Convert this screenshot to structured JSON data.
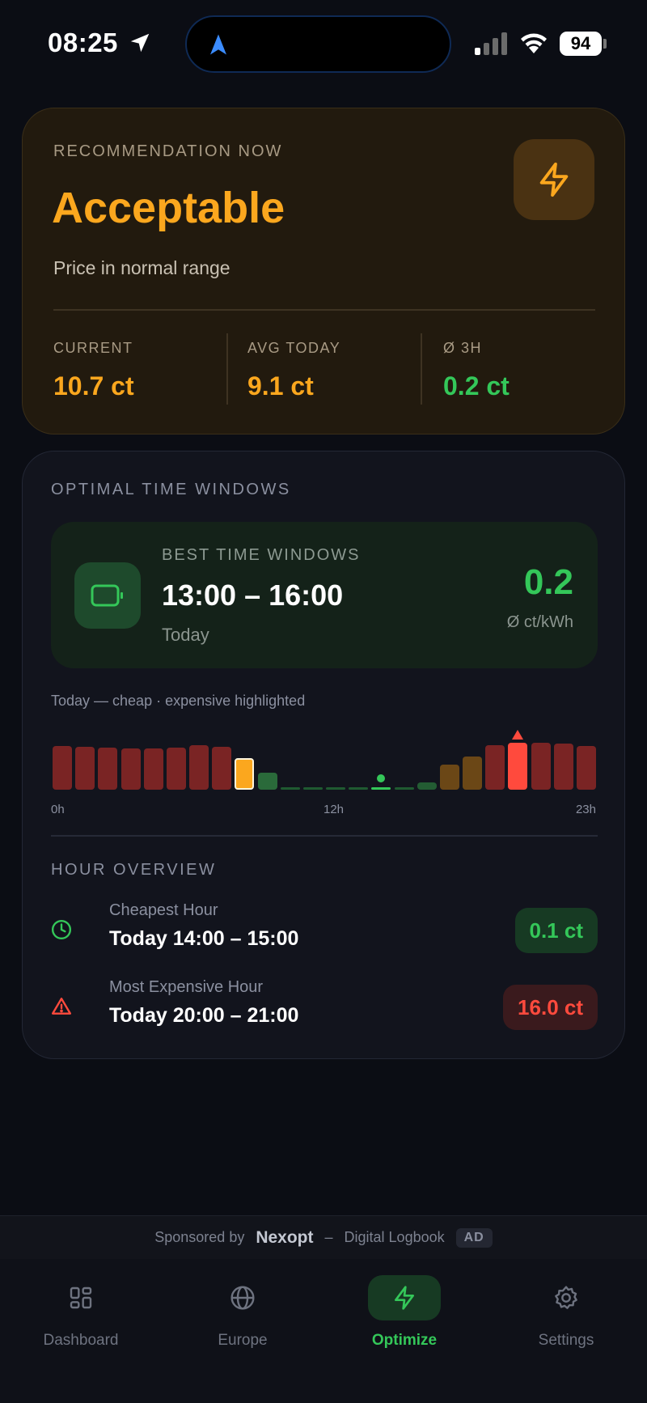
{
  "status_bar": {
    "time": "08:25",
    "battery": "94"
  },
  "colors": {
    "accent_orange": "#fba71e",
    "accent_green": "#34c759",
    "accent_red": "#ff4a3d"
  },
  "recommendation": {
    "label": "RECOMMENDATION NOW",
    "title": "Acceptable",
    "subtitle": "Price in normal range",
    "icon": "lightning-icon",
    "stats": [
      {
        "label": "CURRENT",
        "value": "10.7 ct",
        "color": "#fba71e"
      },
      {
        "label": "AVG TODAY",
        "value": "9.1 ct",
        "color": "#fba71e"
      },
      {
        "label": "Ø 3H",
        "value": "0.2 ct",
        "color": "#34c759"
      }
    ]
  },
  "optimal": {
    "label": "OPTIMAL TIME WINDOWS",
    "best": {
      "label": "BEST TIME WINDOWS",
      "time": "13:00 – 16:00",
      "day": "Today",
      "value": "0.2",
      "unit": "Ø ct/kWh",
      "icon": "battery-icon"
    },
    "chart_caption": "Today — cheap · expensive highlighted",
    "axis": {
      "start": "0h",
      "mid": "12h",
      "end": "23h"
    }
  },
  "chart_data": {
    "type": "bar",
    "categories": [
      "0",
      "1",
      "2",
      "3",
      "4",
      "5",
      "6",
      "7",
      "8",
      "9",
      "10",
      "11",
      "12",
      "13",
      "14",
      "15",
      "16",
      "17",
      "18",
      "19",
      "20",
      "21",
      "22",
      "23"
    ],
    "values": [
      14.8,
      14.6,
      14.2,
      14.0,
      14.0,
      14.3,
      15.1,
      14.6,
      10.7,
      5.8,
      0.6,
      0.4,
      0.4,
      0.5,
      0.1,
      0.7,
      2.4,
      8.4,
      11.2,
      15.1,
      16.0,
      16.0,
      15.6,
      14.8
    ],
    "categories_label_shown": [
      "0h",
      "12h",
      "23h"
    ],
    "highlight": {
      "current_hour": 8,
      "cheapest_hour": 14,
      "most_expensive_hour": 20
    },
    "ylim": [
      0,
      16.5
    ]
  },
  "hour_overview": {
    "label": "HOUR OVERVIEW",
    "cheapest": {
      "title": "Cheapest Hour",
      "time": "Today 14:00 – 15:00",
      "value": "0.1 ct",
      "icon": "clock-icon"
    },
    "expensive": {
      "title": "Most Expensive Hour",
      "time": "Today 20:00 – 21:00",
      "value": "16.0 ct",
      "icon": "warning-icon"
    }
  },
  "sponsor": {
    "prefix": "Sponsored by",
    "brand": "Nexopt",
    "dash": "–",
    "product": "Digital Logbook",
    "badge": "AD"
  },
  "tabs": [
    {
      "label": "Dashboard",
      "icon": "grid-icon"
    },
    {
      "label": "Europe",
      "icon": "globe-icon"
    },
    {
      "label": "Optimize",
      "icon": "lightning-icon",
      "active": true
    },
    {
      "label": "Settings",
      "icon": "gear-icon"
    }
  ]
}
